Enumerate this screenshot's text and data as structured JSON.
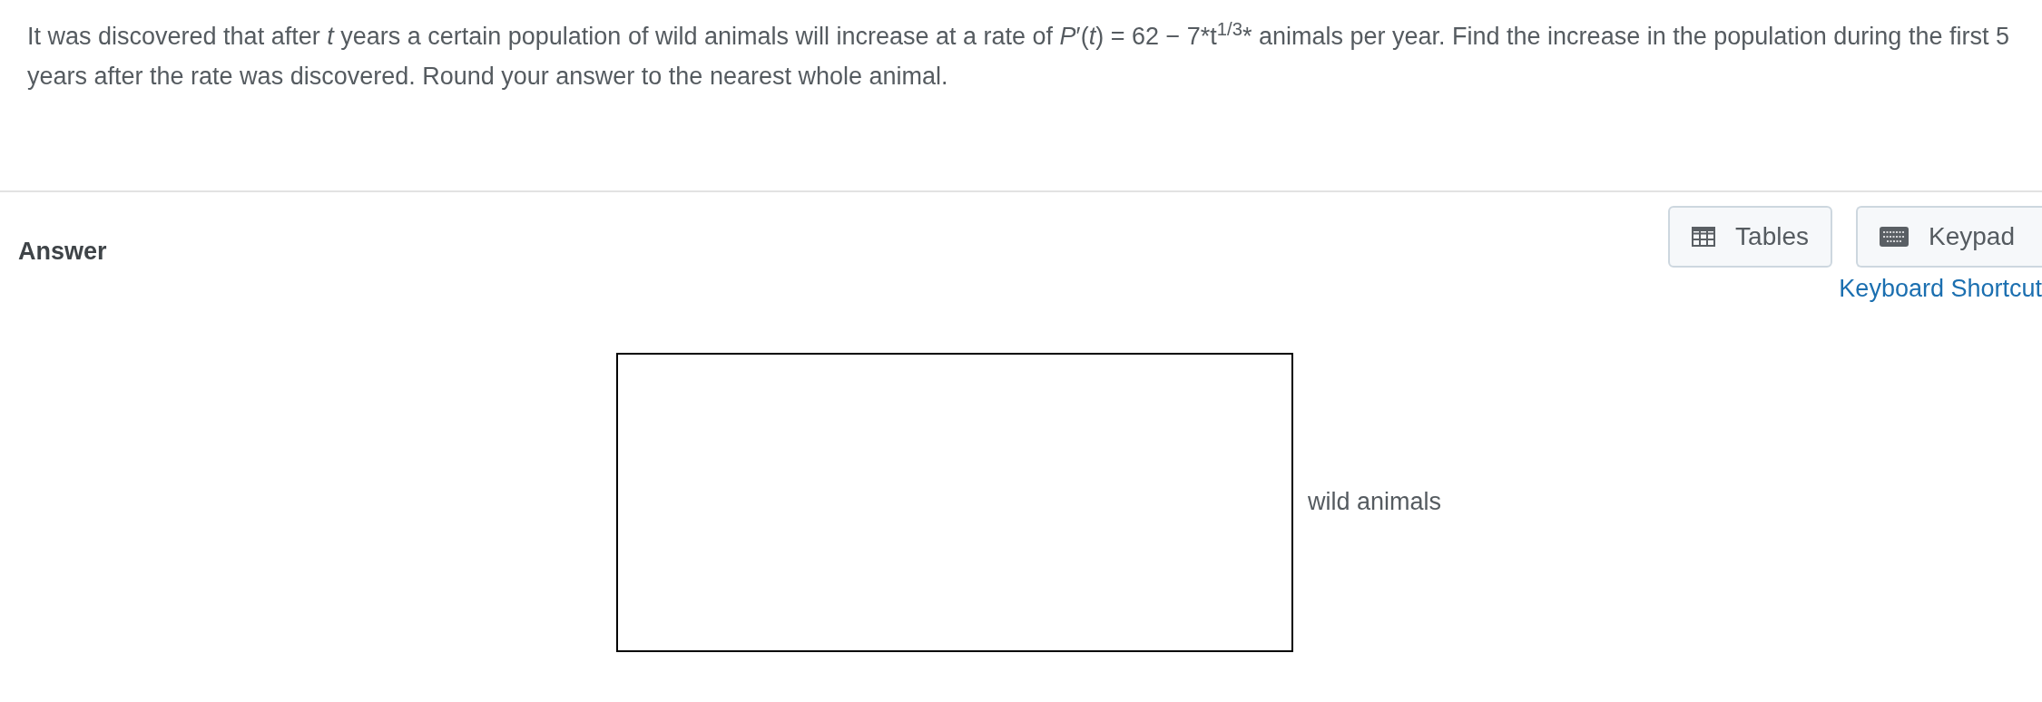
{
  "question": "It was discovered that after *t* years a certain population of wild animals will increase at a rate of *P*′(*t*) = 62 − 7*t$^{1/3}$* animals per year. Find the increase in the population during the first 5 years after the rate was discovered. Round your answer to the nearest whole animal.",
  "answer_heading": "Answer",
  "buttons": [
    {
      "kind": "tables",
      "label": "Tables"
    },
    {
      "kind": "keypad",
      "label": "Keypad"
    }
  ],
  "shortcuts_link": "Keyboard Shortcut",
  "answer_field": {
    "unit": "wild animals"
  }
}
